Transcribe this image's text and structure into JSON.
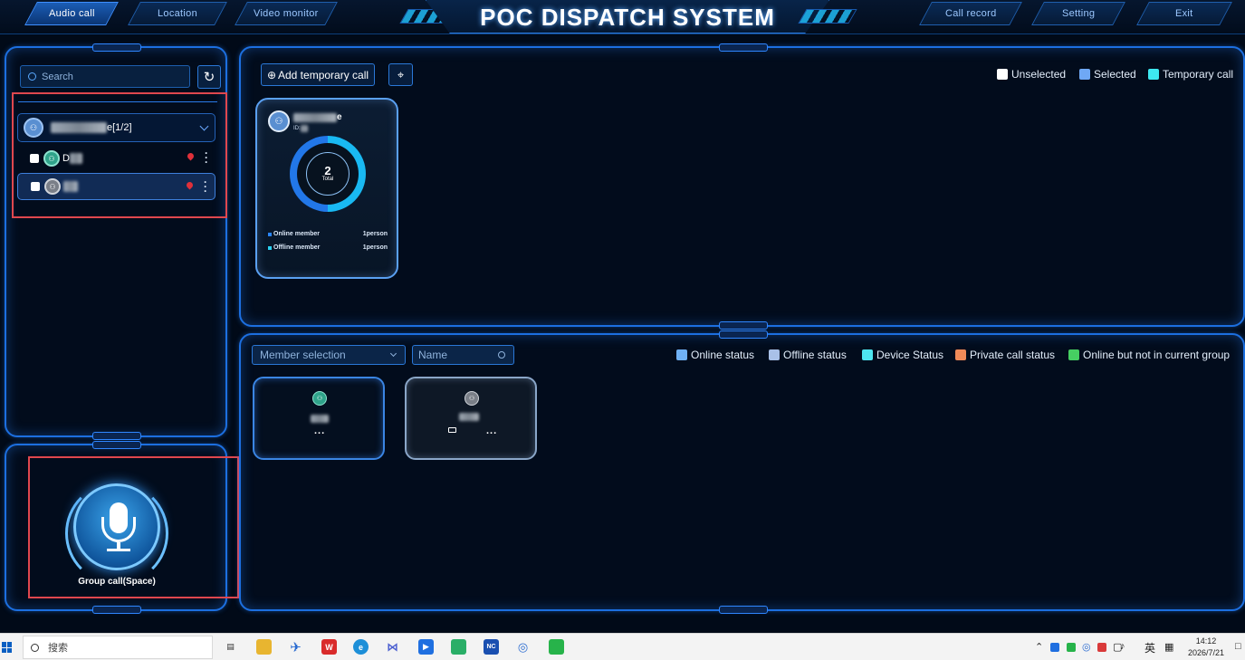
{
  "nav": {
    "left_tabs": [
      "Audio call",
      "Location",
      "Video monitor"
    ],
    "active_tab": "Audio call",
    "title": "POC DISPATCH SYSTEM",
    "right_tabs": [
      "Call record",
      "Setting",
      "Exit"
    ]
  },
  "sidebar": {
    "search_placeholder": "Search",
    "group": {
      "name_suffix": "e[1/2]"
    },
    "members": [
      {
        "name_visible": "D",
        "status": "online",
        "selected": false
      },
      {
        "name_visible": "",
        "status": "offline",
        "selected": true
      }
    ]
  },
  "mic": {
    "label": "Group call(Space)"
  },
  "temp_call": {
    "add_button": "Add temporary call",
    "legend": [
      {
        "label": "Unselected",
        "color": "#ffffff"
      },
      {
        "label": "Selected",
        "color": "#6fa8f5"
      },
      {
        "label": "Temporary call",
        "color": "#3ee8f0"
      }
    ],
    "group_card": {
      "name_suffix": "e",
      "sub_prefix": "ID:",
      "total_number": "2",
      "total_label": "Total",
      "online_label": "Online member",
      "online_value": "1person",
      "offline_label": "Offline member",
      "offline_value": "1person"
    }
  },
  "members_panel": {
    "select_placeholder": "Member selection",
    "name_placeholder": "Name",
    "legend": [
      {
        "label": "Online status",
        "color": "#6fb1f5"
      },
      {
        "label": "Offline status",
        "color": "#a9c1e8"
      },
      {
        "label": "Device Status",
        "color": "#4ee6f0"
      },
      {
        "label": "Private call status",
        "color": "#f08a58"
      },
      {
        "label": "Online but not in current group",
        "color": "#46cf62"
      }
    ],
    "more_label": "..."
  },
  "taskbar": {
    "search_text": "搜索",
    "ime": "英",
    "time": "14:12",
    "date": "2026/7/21"
  }
}
